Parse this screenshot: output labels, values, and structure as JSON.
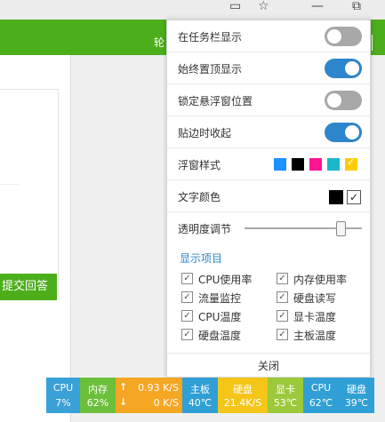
{
  "panel": {
    "toggles": [
      {
        "label": "在任务栏显示",
        "on": false
      },
      {
        "label": "始终置顶显示",
        "on": true
      },
      {
        "label": "锁定悬浮窗位置",
        "on": false
      },
      {
        "label": "贴边时收起",
        "on": true
      }
    ],
    "style_label": "浮窗样式",
    "style_swatches": [
      "#1e90ff",
      "#000000",
      "#ff1493",
      "#1ab7c9",
      "#ffcc00"
    ],
    "text_color_label": "文字颜色",
    "opacity_label": "透明度调节",
    "opacity_level": 0.82,
    "section_title": "显示项目",
    "items": [
      {
        "label": "CPU使用率",
        "checked": true
      },
      {
        "label": "内存使用率",
        "checked": true
      },
      {
        "label": "流量监控",
        "checked": true
      },
      {
        "label": "硬盘读写",
        "checked": true
      },
      {
        "label": "CPU温度",
        "checked": true
      },
      {
        "label": "显卡温度",
        "checked": true
      },
      {
        "label": "硬盘温度",
        "checked": true
      },
      {
        "label": "主板温度",
        "checked": true
      }
    ],
    "close_label": "关闭"
  },
  "background": {
    "green_text": "轮",
    "answer_button": "提交回答"
  },
  "monitor": {
    "cpu": {
      "label": "CPU",
      "value": "7%",
      "color": "#3aa0d8"
    },
    "mem": {
      "label": "内存",
      "value": "62%",
      "color": "#6cbf3a"
    },
    "net": {
      "up": "0.93 K/S",
      "down": "0 K/S",
      "color": "#f5a623"
    },
    "board": {
      "label": "主板",
      "value": "40℃",
      "color": "#2f9fd6"
    },
    "disk": {
      "label": "硬盘",
      "value": "21.4K/S",
      "color": "#f5c518"
    },
    "gpu": {
      "label": "显卡",
      "value": "53℃",
      "color": "#9bc93a"
    },
    "cpu_temp": {
      "label": "CPU",
      "value": "62℃",
      "color": "#2f9fd6"
    },
    "disk_temp": {
      "label": "硬盘",
      "value": "39℃",
      "color": "#2f9fd6"
    }
  }
}
